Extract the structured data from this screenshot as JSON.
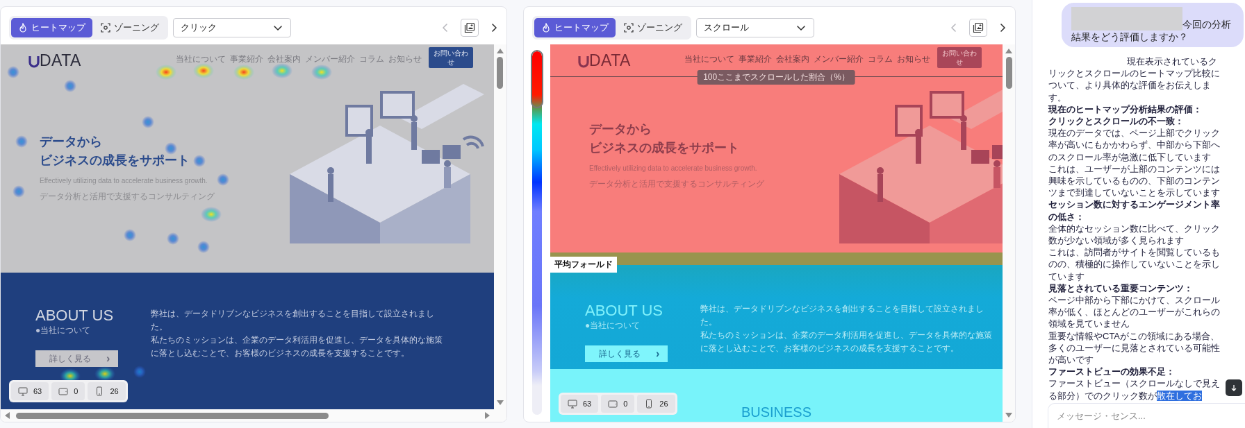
{
  "panels": [
    {
      "kind": "click",
      "tabs": [
        {
          "label": "ヒートマップ",
          "selected": true
        },
        {
          "label": "ゾーニング",
          "selected": false
        }
      ],
      "mode_select": {
        "value": "クリック"
      },
      "prev_disabled": true,
      "site": {
        "logo": "DATA",
        "nav": [
          "当社について",
          "事業紹介",
          "会社案内",
          "メンバー紹介",
          "コラム",
          "お知らせ"
        ],
        "contact_button": "お問い合わせ",
        "hero_title": [
          "データから",
          "ビジネスの成長をサポート"
        ],
        "hero_subtitle": "Effectively utilizing data to accelerate business growth.",
        "hero_tagline": "データ分析と活用で支援するコンサルティング",
        "about": {
          "title": "ABOUT US",
          "subtitle": "●当社について",
          "button": "詳しく見る",
          "button_arrow": "›",
          "body": [
            "弊社は、データドリブンなビジネスを創出することを目指して設立されました。",
            "私たちのミッションは、企業のデータ利活用を促進し、データを具体的な施策に落とし込むことで、お客様のビジネスの成長を支援することです。"
          ]
        }
      },
      "device_counts": [
        {
          "kind": "desktop",
          "count": "63"
        },
        {
          "kind": "tablet",
          "count": "0"
        },
        {
          "kind": "mobile",
          "count": "26"
        }
      ]
    },
    {
      "kind": "scroll",
      "tabs": [
        {
          "label": "ヒートマップ",
          "selected": true
        },
        {
          "label": "ゾーニング",
          "selected": false
        }
      ],
      "mode_select": {
        "value": "スクロール"
      },
      "prev_disabled": true,
      "scroll_marker": "100ここまでスクロールした割合（%）",
      "fold_label": "平均フォールド",
      "site": {
        "logo": "DATA",
        "nav": [
          "当社について",
          "事業紹介",
          "会社案内",
          "メンバー紹介",
          "コラム",
          "お知らせ"
        ],
        "contact_button": "お問い合わせ",
        "hero_title": [
          "データから",
          "ビジネスの成長をサポート"
        ],
        "hero_subtitle": "Effectively utilizing data to accelerate business growth.",
        "hero_tagline": "データ分析と活用で支援するコンサルティング",
        "about": {
          "title": "ABOUT US",
          "subtitle": "●当社について",
          "button": "詳しく見る",
          "button_arrow": "›",
          "body": [
            "弊社は、データドリブンなビジネスを創出することを目指して設立されました。",
            "私たちのミッションは、企業のデータ利活用を促進し、データを具体的な施策に落とし込むことで、お客様のビジネスの成長を支援することです。"
          ]
        },
        "next_section": "BUSINESS"
      },
      "device_counts": [
        {
          "kind": "desktop",
          "count": "63"
        },
        {
          "kind": "tablet",
          "count": "0"
        },
        {
          "kind": "mobile",
          "count": "26"
        }
      ]
    }
  ],
  "chat": {
    "user_message": {
      "redacted": true,
      "text": "今回の分析結果をどう評価しますか？"
    },
    "assistant_paragraphs": [
      {
        "kind": "text",
        "text": "現在表示されているクリックとスクロールのヒートマップ比較について、より具体的な評価をお伝えします。"
      },
      {
        "kind": "heading",
        "text": "現在のヒートマップ分析結果の評価："
      },
      {
        "kind": "heading",
        "text": "クリックとスクロールの不一致："
      },
      {
        "kind": "text",
        "text": "現在のデータでは、ページ上部でクリック率が高いにもかかわらず、中部から下部へのスクロール率が急激に低下しています"
      },
      {
        "kind": "text",
        "text": "これは、ユーザーが上部のコンテンツには興味を示しているものの、下部のコンテンツまで到達していないことを示しています"
      },
      {
        "kind": "heading",
        "text": "セッション数に対するエンゲージメント率の低さ："
      },
      {
        "kind": "text",
        "text": "全体的なセッション数に比べて、クリック数が少ない領域が多く見られます"
      },
      {
        "kind": "text",
        "text": "これは、訪問者がサイトを閲覧しているものの、積極的に操作していないことを示しています"
      },
      {
        "kind": "heading",
        "text": "見落とされている重要コンテンツ："
      },
      {
        "kind": "text",
        "text": "ページ中部から下部にかけて、スクロール率が低く、ほとんどのユーザーがこれらの領域を見ていません"
      },
      {
        "kind": "text",
        "text": "重要な情報やCTAがこの領域にある場合、多くのユーザーに見落とされている可能性が高いです"
      },
      {
        "kind": "heading",
        "text": "ファーストビューの効果不足："
      },
      {
        "kind": "text",
        "text": "ファーストビュー（スクロールなしで見える部分）でのクリック数が",
        "selected_text": "散在してお"
      }
    ],
    "input": {
      "placeholder": "メッセージ・センス..."
    }
  }
}
